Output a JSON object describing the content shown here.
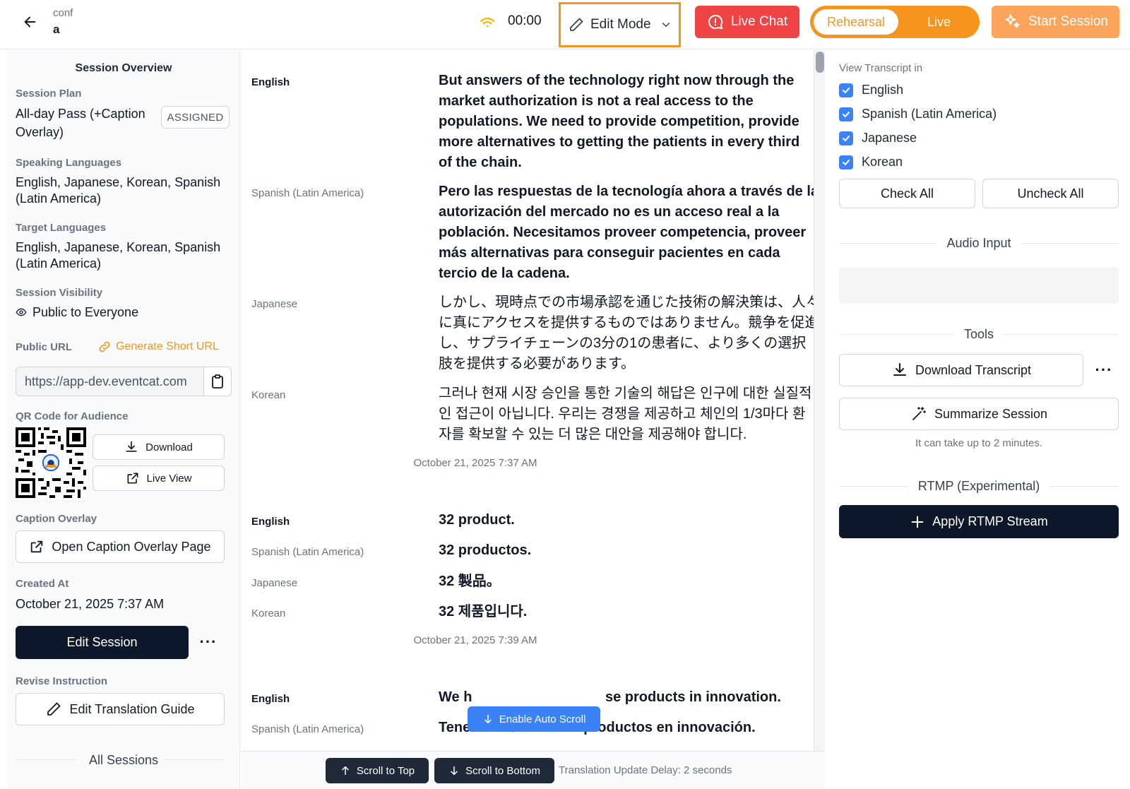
{
  "header": {
    "breadcrumb_parent": "conf",
    "breadcrumb_current": "a",
    "timer": "00:00",
    "edit_mode_label": "Edit Mode",
    "live_chat_label": "Live Chat",
    "mode_rehearsal": "Rehearsal",
    "mode_live": "Live",
    "start_session_label": "Start Session"
  },
  "sidebar": {
    "overview_title": "Session Overview",
    "session_plan_label": "Session Plan",
    "session_plan_line1": "All-day Pass (+Caption",
    "session_plan_line2": "Overlay)",
    "session_plan_badge": "ASSIGNED",
    "speaking_label": "Speaking Languages",
    "speaking_line1": "English, Japanese, Korean, Spanish",
    "speaking_line2": "(Latin America)",
    "target_label": "Target Languages",
    "target_line1": "English, Japanese, Korean, Spanish",
    "target_line2": "(Latin America)",
    "visibility_label": "Session Visibility",
    "visibility_value": "Public to Everyone",
    "public_url_label": "Public URL",
    "generate_short_url": "Generate Short URL",
    "public_url_value": "https://app-dev.eventcat.com",
    "qr_label": "QR Code for Audience",
    "qr_download": "Download",
    "qr_live_view": "Live View",
    "caption_label": "Caption Overlay",
    "open_caption": "Open Caption Overlay Page",
    "created_label": "Created At",
    "created_value": "October 21, 2025 7:37 AM",
    "edit_session": "Edit Session",
    "revise_label": "Revise Instruction",
    "edit_guide": "Edit Translation Guide",
    "all_sessions": "All Sessions"
  },
  "transcript": {
    "blocks": [
      {
        "lines": [
          {
            "lang": "English",
            "text": "But answers of the technology right now through the market authorization is not a real access to the populations. We need to provide competition, provide more alternatives to getting the patients in every third of the chain."
          },
          {
            "lang": "Spanish (Latin America)",
            "text": "Pero las respuestas de la tecnología ahora a través de la autorización del mercado no es un acceso real a la población. Necesitamos proveer competencia, proveer más alternativas para conseguir pacientes en cada tercio de la cadena."
          },
          {
            "lang": "Japanese",
            "text": "しかし、現時点での市場承認を通じた技術の解決策は、人々に真にアクセスを提供するものではありません。競争を促進し、サプライチェーンの3分の1の患者に、より多くの選択肢を提供する必要があります。"
          },
          {
            "lang": "Korean",
            "text": "그러나 현재 시장 승인을 통한 기술의 해답은 인구에 대한 실질적인 접근이 아닙니다. 우리는 경쟁을 제공하고 체인의 1/3마다 환자를 확보할 수 있는 더 많은 대안을 제공해야 합니다."
          }
        ],
        "timestamp": "October 21, 2025 7:37 AM"
      },
      {
        "lines": [
          {
            "lang": "English",
            "text": "32 product."
          },
          {
            "lang": "Spanish (Latin America)",
            "text": "32 productos."
          },
          {
            "lang": "Japanese",
            "text": "32 製品。"
          },
          {
            "lang": "Korean",
            "text": "32 제품입니다."
          }
        ],
        "timestamp": "October 21, 2025 7:39 AM"
      },
      {
        "lines": [
          {
            "lang": "English",
            "text": "We h"
          },
          {
            "lang": "Spanish (Latin America)",
            "text": "Tenemos 1/2 de esos productos en innovación."
          }
        ],
        "english_tail": "se products in innovation."
      }
    ],
    "auto_scroll": "Enable Auto Scroll",
    "scroll_top": "Scroll to Top",
    "scroll_bottom": "Scroll to Bottom",
    "delay_text": "Translation Update Delay: 2 seconds"
  },
  "right_panel": {
    "view_in_label": "View Transcript in",
    "languages": [
      {
        "name": "English",
        "checked": true
      },
      {
        "name": "Spanish (Latin America)",
        "checked": true
      },
      {
        "name": "Japanese",
        "checked": true
      },
      {
        "name": "Korean",
        "checked": true
      }
    ],
    "check_all": "Check All",
    "uncheck_all": "Uncheck All",
    "audio_input_title": "Audio Input",
    "tools_title": "Tools",
    "download_transcript": "Download Transcript",
    "summarize_session": "Summarize Session",
    "summarize_note": "It can take up to 2 minutes.",
    "rtmp_title": "RTMP (Experimental)",
    "apply_rtmp": "Apply RTMP Stream"
  },
  "colors": {
    "accent_orange": "#f7941d",
    "live_chat_red": "#ef4444",
    "dark_button": "#0f172a",
    "checkbox_blue": "#3b82f6"
  }
}
